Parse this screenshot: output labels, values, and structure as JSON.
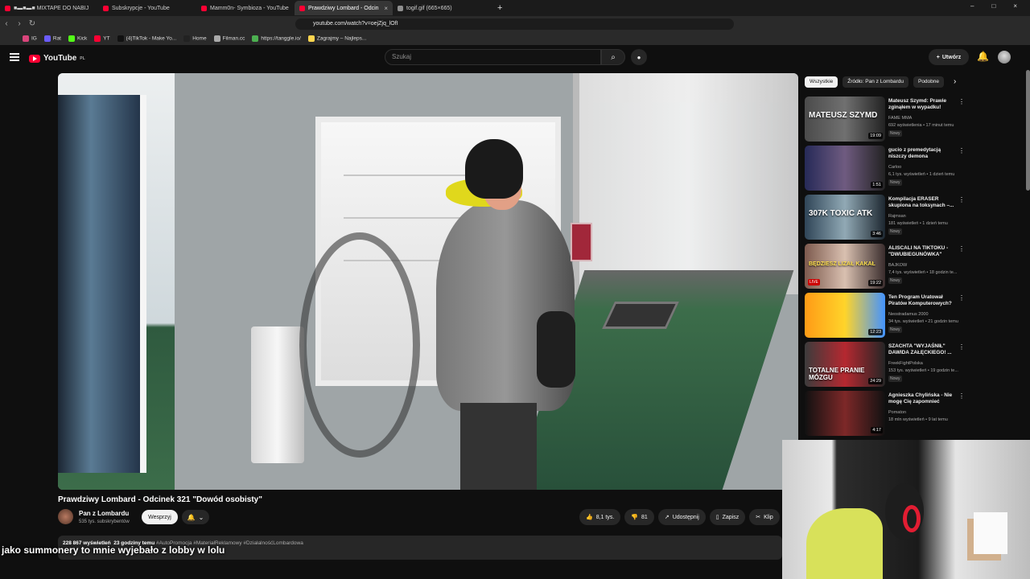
{
  "browser": {
    "tabs": [
      {
        "label": "■▬■▬■ MIXTAPE DO NABIJ",
        "icon": "youtube-icon"
      },
      {
        "label": "Subskrypcje - YouTube",
        "icon": "youtube-icon"
      },
      {
        "label": "Mamm0n- Symbioza - YouTube",
        "icon": "youtube-icon"
      },
      {
        "label": "Prawdziwy Lombard - Odcin",
        "icon": "youtube-icon",
        "active": true
      },
      {
        "label": "togif.gif (665×665)",
        "icon": "image-icon"
      }
    ],
    "new_tab": "+",
    "url": "youtube.com/watch?v=oejZjq_lOfI",
    "bookmarks": [
      "IG",
      "Rat",
      "Kick",
      "YT",
      "(4)TikTok - Make Yo...",
      "Home",
      "Filman.cc",
      "https://tanggle.io/",
      "Zagrajmy – Najleps..."
    ],
    "window_controls": [
      "–",
      "□",
      "×"
    ]
  },
  "youtube": {
    "logo": "YouTube",
    "country": "PL",
    "search_placeholder": "Szukaj",
    "create_label": "Utwórz"
  },
  "video": {
    "title": "Prawdziwy Lombard - Odcinek 321 \"Dowód osobisty\"",
    "channel": "Pan z Lombardu",
    "subscribers": "535 tys. subskrybentów",
    "support_label": "Wesprzyj",
    "likes": "8,1 tys.",
    "dislikes": "81",
    "share": "Udostępnij",
    "save": "Zapisz",
    "clip": "Klip",
    "views": "228 867 wyświetleń",
    "age": "23 godziny temu",
    "tags": "#AutoPromocja #MateriałReklamowy #DziałalnośćLombardowa"
  },
  "caption": "jako summonery to mnie wyjebało z lobby w lolu",
  "filters": [
    "Wszystkie",
    "Źródło: Pan z Lombardu",
    "Podobne"
  ],
  "recommendations": [
    {
      "title": "Mateusz Szymd: Prawie zginąłem w wypadku!",
      "channel": "FAME MMA",
      "meta": "692 wyświetlenia • 17 minut temu",
      "badge": "Nowy",
      "duration": "19:09",
      "thumb_text": "MATEUSZ SZYMD"
    },
    {
      "title": "gucio z premedytacją niszczy demona",
      "channel": "Carloo",
      "meta": "6,1 tys. wyświetleń • 1 dzień temu",
      "badge": "Nowy",
      "duration": "1:51",
      "thumb_text": ""
    },
    {
      "title": "Kompilacja ERASER skupiona na toksynach –...",
      "channel": "Rajmsan",
      "meta": "181 wyświetleń • 1 dzień temu",
      "badge": "Nowy",
      "duration": "3:46",
      "thumb_text": "307K TOXIC ATK"
    },
    {
      "title": "ALISCALI NA TIKTOKU - \"DWUBIEGUNÓWKA\"",
      "channel": "BAJKOW",
      "meta": "7,4 tys. wyświetleń • 18 godzin te...",
      "badge": "Nowy",
      "duration": "19:22",
      "thumb_text": "BĘDZIESZ LIZAŁ KAKAŁ",
      "live": "LIVE"
    },
    {
      "title": "Ten Program Uratował Piratów Komputerowych?",
      "channel": "Neostradamus 2000",
      "meta": "34 tys. wyświetleń • 21 godzin temu",
      "badge": "Nowy",
      "duration": "12:23",
      "thumb_text": ""
    },
    {
      "title": "SZACHTA \"WYJAŚNIŁ\" DAWIDA ZAŁĘCKIEGO! ...",
      "channel": "FreekFightPolska",
      "meta": "153 tys. wyświetleń • 19 godzin te...",
      "badge": "Nowy",
      "duration": "24:29",
      "thumb_text": "TOTALNE PRANIE MÓZGU"
    },
    {
      "title": "Agnieszka Chylińska - Nie mogę Cię zapomnieć",
      "channel": "Pomaton",
      "meta": "18 mln wyświetleń • 9 lat temu",
      "badge": "",
      "duration": "4:17",
      "thumb_text": ""
    }
  ],
  "colors": {
    "youtube_red": "#ff0033",
    "background": "#0f0f0f",
    "panel": "#272727"
  }
}
